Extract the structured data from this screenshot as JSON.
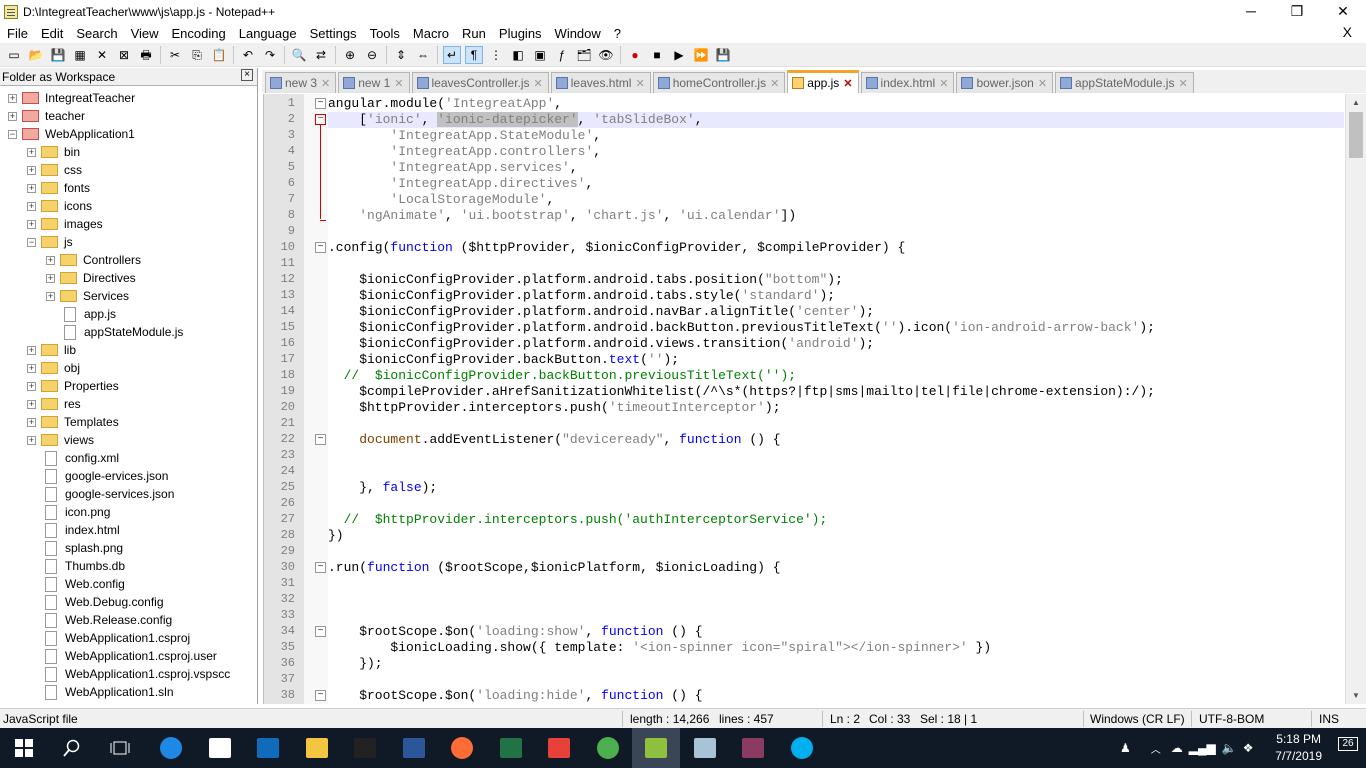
{
  "window": {
    "title": "D:\\IntegreatTeacher\\www\\js\\app.js - Notepad++",
    "controls": [
      "─",
      "❐",
      "✕"
    ]
  },
  "menu": {
    "items": [
      "File",
      "Edit",
      "Search",
      "View",
      "Encoding",
      "Language",
      "Settings",
      "Tools",
      "Macro",
      "Run",
      "Plugins",
      "Window",
      "?"
    ],
    "close_doc": "X"
  },
  "toolbar": {
    "icons": [
      "new-file-icon",
      "open-file-icon",
      "save-icon",
      "save-all-icon",
      "close-icon",
      "close-all-icon",
      "print-icon",
      "cut-icon",
      "copy-icon",
      "paste-icon",
      "undo-icon",
      "redo-icon",
      "find-icon",
      "replace-icon",
      "zoom-in-icon",
      "zoom-out-icon",
      "sync-vertical-icon",
      "sync-horizontal-icon",
      "word-wrap-icon",
      "show-all-chars-icon",
      "indent-guide-icon",
      "user-language-icon",
      "doc-map-icon",
      "function-list-icon",
      "folder-workspace-icon",
      "monitor-icon",
      "record-macro-icon",
      "stop-record-icon",
      "play-macro-icon",
      "run-macro-multiple-icon",
      "save-macro-icon"
    ]
  },
  "panel": {
    "title": "Folder as Workspace",
    "close": "×"
  },
  "tree": [
    {
      "label": "IntegreatTeacher",
      "level": 0,
      "type": "folder-red",
      "exp": "+"
    },
    {
      "label": "teacher",
      "level": 0,
      "type": "folder-red",
      "exp": "+"
    },
    {
      "label": "WebApplication1",
      "level": 0,
      "type": "folder-red",
      "exp": "-"
    },
    {
      "label": "bin",
      "level": 1,
      "type": "folder",
      "exp": "+"
    },
    {
      "label": "css",
      "level": 1,
      "type": "folder",
      "exp": "+"
    },
    {
      "label": "fonts",
      "level": 1,
      "type": "folder",
      "exp": "+"
    },
    {
      "label": "icons",
      "level": 1,
      "type": "folder",
      "exp": "+"
    },
    {
      "label": "images",
      "level": 1,
      "type": "folder",
      "exp": "+"
    },
    {
      "label": "js",
      "level": 1,
      "type": "folder",
      "exp": "-"
    },
    {
      "label": "Controllers",
      "level": 2,
      "type": "folder",
      "exp": "+"
    },
    {
      "label": "Directives",
      "level": 2,
      "type": "folder",
      "exp": "+"
    },
    {
      "label": "Services",
      "level": 2,
      "type": "folder",
      "exp": "+"
    },
    {
      "label": "app.js",
      "level": 2,
      "type": "file",
      "exp": ""
    },
    {
      "label": "appStateModule.js",
      "level": 2,
      "type": "file",
      "exp": ""
    },
    {
      "label": "lib",
      "level": 1,
      "type": "folder",
      "exp": "+"
    },
    {
      "label": "obj",
      "level": 1,
      "type": "folder",
      "exp": "+"
    },
    {
      "label": "Properties",
      "level": 1,
      "type": "folder",
      "exp": "+"
    },
    {
      "label": "res",
      "level": 1,
      "type": "folder",
      "exp": "+"
    },
    {
      "label": "Templates",
      "level": 1,
      "type": "folder",
      "exp": "+"
    },
    {
      "label": "views",
      "level": 1,
      "type": "folder",
      "exp": "+"
    },
    {
      "label": "config.xml",
      "level": 1,
      "type": "file",
      "exp": ""
    },
    {
      "label": "google-ervices.json",
      "level": 1,
      "type": "file",
      "exp": ""
    },
    {
      "label": "google-services.json",
      "level": 1,
      "type": "file",
      "exp": ""
    },
    {
      "label": "icon.png",
      "level": 1,
      "type": "file",
      "exp": ""
    },
    {
      "label": "index.html",
      "level": 1,
      "type": "file",
      "exp": ""
    },
    {
      "label": "splash.png",
      "level": 1,
      "type": "file",
      "exp": ""
    },
    {
      "label": "Thumbs.db",
      "level": 1,
      "type": "file",
      "exp": ""
    },
    {
      "label": "Web.config",
      "level": 1,
      "type": "file",
      "exp": ""
    },
    {
      "label": "Web.Debug.config",
      "level": 1,
      "type": "file",
      "exp": ""
    },
    {
      "label": "Web.Release.config",
      "level": 1,
      "type": "file",
      "exp": ""
    },
    {
      "label": "WebApplication1.csproj",
      "level": 1,
      "type": "file",
      "exp": ""
    },
    {
      "label": "WebApplication1.csproj.user",
      "level": 1,
      "type": "file",
      "exp": ""
    },
    {
      "label": "WebApplication1.csproj.vspscc",
      "level": 1,
      "type": "file",
      "exp": ""
    },
    {
      "label": "WebApplication1.sln",
      "level": 1,
      "type": "file",
      "exp": ""
    }
  ],
  "tabs": [
    {
      "label": "new 3",
      "active": false
    },
    {
      "label": "new 1",
      "active": false
    },
    {
      "label": "leavesController.js",
      "active": false
    },
    {
      "label": "leaves.html",
      "active": false
    },
    {
      "label": "homeController.js",
      "active": false
    },
    {
      "label": "app.js",
      "active": true
    },
    {
      "label": "index.html",
      "active": false
    },
    {
      "label": "bower.json",
      "active": false
    },
    {
      "label": "appStateModule.js",
      "active": false
    }
  ],
  "tab_close": "✕",
  "code_lines": [
    {
      "n": "1",
      "fold": "-",
      "html": "angular.module(<span class=\"str\">'IntegreatApp'</span>,"
    },
    {
      "n": "2",
      "fold": "-r",
      "cur": true,
      "html": "    [<span class=\"str\">'ionic'</span>, <span class=\"str hl\">'ionic-datepicker'</span>, <span class=\"str\">'tabSlideBox'</span>,"
    },
    {
      "n": "3",
      "html": "        <span class=\"str\">'IntegreatApp.StateModule'</span>,"
    },
    {
      "n": "4",
      "html": "        <span class=\"str\">'IntegreatApp.controllers'</span>,"
    },
    {
      "n": "5",
      "html": "        <span class=\"str\">'IntegreatApp.services'</span>,"
    },
    {
      "n": "6",
      "html": "        <span class=\"str\">'IntegreatApp.directives'</span>,"
    },
    {
      "n": "7",
      "html": "        <span class=\"str\">'LocalStorageModule'</span>,"
    },
    {
      "n": "8",
      "html": "    <span class=\"str\">'ngAnimate'</span>, <span class=\"str\">'ui.bootstrap'</span>, <span class=\"str\">'chart.js'</span>, <span class=\"str\">'ui.calendar'</span>])"
    },
    {
      "n": "9",
      "html": ""
    },
    {
      "n": "10",
      "fold": "-",
      "html": ".config(<span class=\"kw\">function</span> ($httpProvider, $ionicConfigProvider, $compileProvider) {"
    },
    {
      "n": "11",
      "html": ""
    },
    {
      "n": "12",
      "html": "    $ionicConfigProvider.platform.android.tabs.position(<span class=\"str\">\"bottom\"</span>);"
    },
    {
      "n": "13",
      "html": "    $ionicConfigProvider.platform.android.tabs.style(<span class=\"str\">'standard'</span>);"
    },
    {
      "n": "14",
      "html": "    $ionicConfigProvider.platform.android.navBar.alignTitle(<span class=\"str\">'center'</span>);"
    },
    {
      "n": "15",
      "html": "    $ionicConfigProvider.platform.android.backButton.previousTitleText(<span class=\"str\">''</span>).icon(<span class=\"str\">'ion-android-arrow-back'</span>);"
    },
    {
      "n": "16",
      "html": "    $ionicConfigProvider.platform.android.views.transition(<span class=\"str\">'android'</span>);"
    },
    {
      "n": "17",
      "html": "    $ionicConfigProvider.backButton.<span class=\"kw\">text</span>(<span class=\"str\">''</span>);"
    },
    {
      "n": "18",
      "html": "  <span class=\"cm\">//  $ionicConfigProvider.backButton.previousTitleText('');</span>"
    },
    {
      "n": "19",
      "html": "    $compileProvider.aHrefSanitizationWhitelist(/^\\s*(https?|ftp|sms|mailto|tel|file|chrome-extension):/);"
    },
    {
      "n": "20",
      "html": "    $httpProvider.interceptors.push(<span class=\"str\">'timeoutInterceptor'</span>);"
    },
    {
      "n": "21",
      "html": ""
    },
    {
      "n": "22",
      "fold": "-",
      "html": "    <span class=\"kw\" style=\"color:#804000\">document</span>.addEventListener(<span class=\"str\">\"deviceready\"</span>, <span class=\"kw\">function</span> () {"
    },
    {
      "n": "23",
      "html": ""
    },
    {
      "n": "24",
      "html": ""
    },
    {
      "n": "25",
      "html": "    }, <span class=\"kw\">false</span>);"
    },
    {
      "n": "26",
      "html": ""
    },
    {
      "n": "27",
      "html": "  <span class=\"cm\">//  $httpProvider.interceptors.push('authInterceptorService');</span>"
    },
    {
      "n": "28",
      "html": "})"
    },
    {
      "n": "29",
      "html": ""
    },
    {
      "n": "30",
      "fold": "-",
      "html": ".run(<span class=\"kw\">function</span> ($rootScope,$ionicPlatform, $ionicLoading) {"
    },
    {
      "n": "31",
      "html": ""
    },
    {
      "n": "32",
      "html": ""
    },
    {
      "n": "33",
      "html": ""
    },
    {
      "n": "34",
      "fold": "-",
      "html": "    $rootScope.$on(<span class=\"str\">'loading:show'</span>, <span class=\"kw\">function</span> () {"
    },
    {
      "n": "35",
      "html": "        $ionicLoading.show({ template: <span class=\"str\">'&lt;ion-spinner icon=\"spiral\"&gt;&lt;/ion-spinner&gt;'</span> })"
    },
    {
      "n": "36",
      "html": "    });"
    },
    {
      "n": "37",
      "html": ""
    },
    {
      "n": "38",
      "fold": "-",
      "html": "    $rootScope.$on(<span class=\"str\">'loading:hide'</span>, <span class=\"kw\">function</span> () {"
    }
  ],
  "status": {
    "file_type": "JavaScript file",
    "length": "length : 14,266",
    "lines": "lines : 457",
    "ln": "Ln : 2",
    "col": "Col : 33",
    "sel": "Sel : 18 | 1",
    "eol": "Windows (CR LF)",
    "encoding": "UTF-8-BOM",
    "mode": "INS"
  },
  "taskbar": {
    "time": "5:18 PM",
    "date": "7/7/2019",
    "notifications": "26",
    "apps": [
      {
        "name": "edge-icon",
        "color": "#1e88e5"
      },
      {
        "name": "mail-icon",
        "color": "#ffffff"
      },
      {
        "name": "outlook-icon",
        "color": "#0f6cbd"
      },
      {
        "name": "file-explorer-icon",
        "color": "#f3c641"
      },
      {
        "name": "cmd-icon",
        "color": "#222222"
      },
      {
        "name": "word-icon",
        "color": "#2b579a"
      },
      {
        "name": "postman-icon",
        "color": "#ff6c37"
      },
      {
        "name": "excel-icon",
        "color": "#217346"
      },
      {
        "name": "git-icon",
        "color": "#e8413a"
      },
      {
        "name": "chrome-icon",
        "color": "#4caf50"
      },
      {
        "name": "notepadpp-icon",
        "color": "#8fbf3f"
      },
      {
        "name": "paint-icon",
        "color": "#a9c3d6"
      },
      {
        "name": "winrar-icon",
        "color": "#8b3a62"
      },
      {
        "name": "skype-icon",
        "color": "#00aff0"
      }
    ]
  }
}
